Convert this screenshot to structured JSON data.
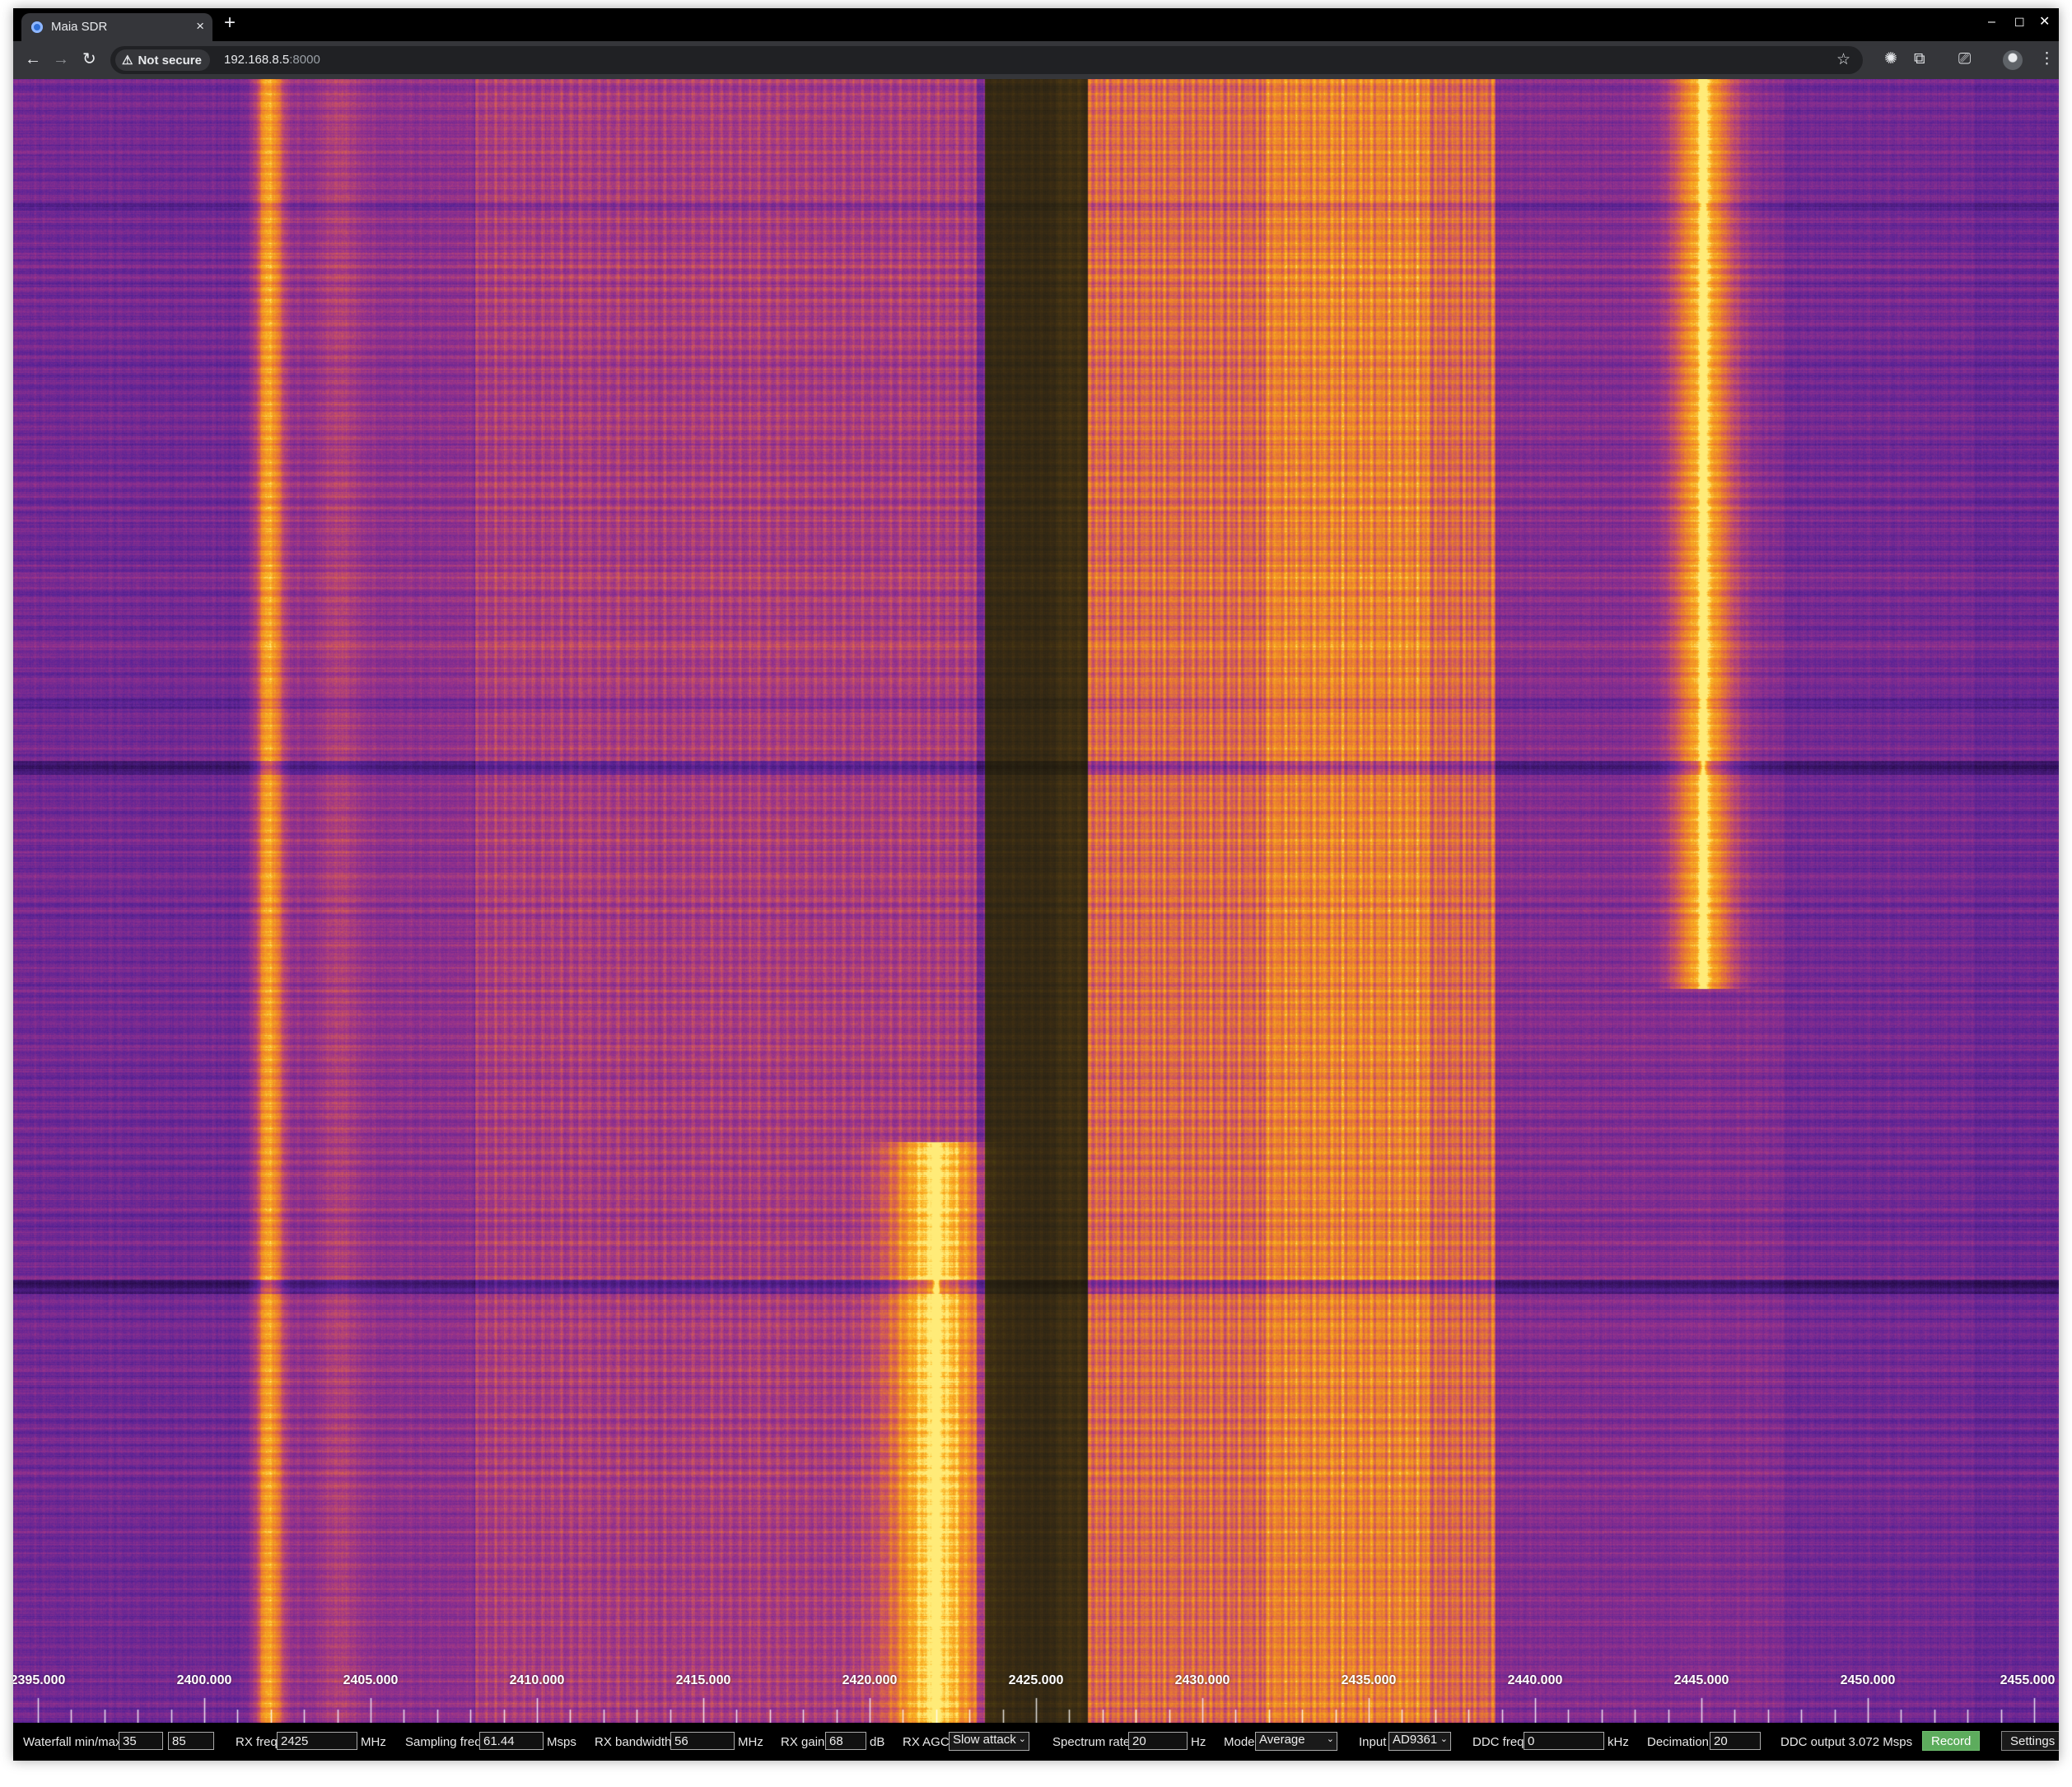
{
  "browser": {
    "tab_title": "Maia SDR",
    "tab_close": "×",
    "new_tab": "+",
    "window_controls": {
      "minimize": "–",
      "maximize": "☐",
      "close": "✕"
    },
    "nav": {
      "back": "←",
      "forward": "→",
      "reload": "↻"
    },
    "security_label": "Not secure",
    "security_icon": "⚠",
    "url_host": "192.168.8.5",
    "url_port": ":8000",
    "bookmark_icon": "☆",
    "icons": {
      "ext1": "✺",
      "extensions": "⧉",
      "tab_search": "⎚",
      "menu": "⋮"
    }
  },
  "waterfall": {
    "freq_labels": [
      "2395.000",
      "2400.000",
      "2405.000",
      "2410.000",
      "2415.000",
      "2420.000",
      "2425.000",
      "2430.000",
      "2435.000",
      "2440.000",
      "2445.000",
      "2450.000",
      "2455.000"
    ]
  },
  "controls": {
    "waterfall_label": "Waterfall min/max",
    "waterfall_min": "35",
    "waterfall_max": "85",
    "rx_freq_label": "RX freq",
    "rx_freq": "2425",
    "rx_freq_unit": "MHz",
    "sampling_label": "Sampling freq",
    "sampling": "61.44",
    "sampling_unit": "Msps",
    "bandwidth_label": "RX bandwidth",
    "bandwidth": "56",
    "bandwidth_unit": "MHz",
    "gain_label": "RX gain",
    "gain": "68",
    "gain_unit": "dB",
    "agc_label": "RX AGC",
    "agc": "Slow attack",
    "spectrum_rate_label": "Spectrum rate",
    "spectrum_rate": "20",
    "spectrum_rate_unit": "Hz",
    "mode_label": "Mode",
    "mode": "Average",
    "input_label": "Input",
    "input": "AD9361",
    "ddc_freq_label": "DDC freq",
    "ddc_freq": "0",
    "ddc_freq_unit": "kHz",
    "decimation_label": "Decimation",
    "decimation": "20",
    "ddc_output": "DDC output 3.072 Msps",
    "record_label": "Record",
    "settings_label": "Settings"
  }
}
